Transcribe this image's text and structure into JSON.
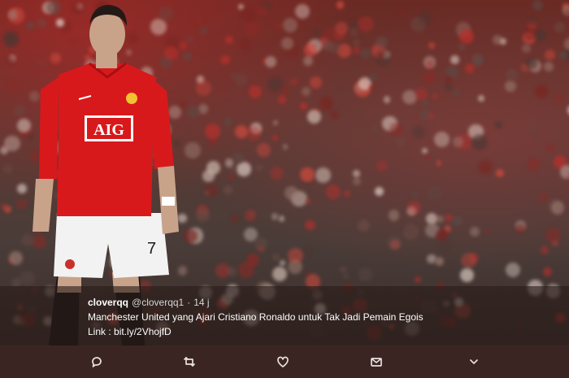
{
  "tweet": {
    "display_name": "cloverqq",
    "handle": "@cloverqq1",
    "separator": "·",
    "time": "14 j",
    "text": "Manchester United yang Ajari Cristiano Ronaldo untuk Tak Jadi Pemain Egois",
    "link_label": "Link : ",
    "link_text": "bit.ly/2VhojfD"
  },
  "photo": {
    "sponsor": "AIG",
    "shirt_number": "7"
  },
  "actions": [
    {
      "name": "reply",
      "icon": "reply-icon"
    },
    {
      "name": "retweet",
      "icon": "retweet-icon"
    },
    {
      "name": "like",
      "icon": "heart-icon"
    },
    {
      "name": "message",
      "icon": "envelope-icon"
    },
    {
      "name": "more",
      "icon": "chevron-down-icon"
    }
  ],
  "colors": {
    "jersey_red": "#d8191c",
    "shorts_white": "#f2f2f2",
    "action_bar": "#3b2522"
  }
}
